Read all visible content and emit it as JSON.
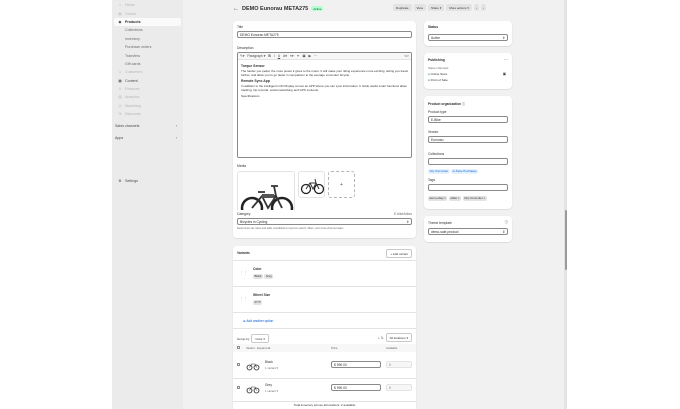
{
  "sidebar": {
    "items": [
      {
        "label": "Home",
        "icon": "home-icon",
        "state": "dim"
      },
      {
        "label": "Orders",
        "icon": "orders-icon",
        "state": "dim"
      },
      {
        "label": "Products",
        "icon": "tag-icon",
        "state": "active"
      },
      {
        "label": "Collections",
        "state": "sub"
      },
      {
        "label": "Inventory",
        "state": "sub"
      },
      {
        "label": "Purchase orders",
        "state": "sub"
      },
      {
        "label": "Transfers",
        "state": "sub"
      },
      {
        "label": "Gift cards",
        "state": "sub"
      },
      {
        "label": "Customers",
        "icon": "person-icon",
        "state": "dim"
      },
      {
        "label": "Content",
        "icon": "content-icon",
        "state": "dark"
      },
      {
        "label": "Finances",
        "icon": "bank-icon",
        "state": "dim"
      },
      {
        "label": "Analytics",
        "icon": "chart-icon",
        "state": "dim"
      },
      {
        "label": "Marketing",
        "icon": "target-icon",
        "state": "dim"
      },
      {
        "label": "Discounts",
        "icon": "discount-icon",
        "state": "dim"
      }
    ],
    "sales_channels_label": "Sales channels",
    "apps_label": "Apps",
    "settings_label": "Settings"
  },
  "header": {
    "title": "DEMO Eunorau META275",
    "status": "Active",
    "actions": [
      "Duplicate",
      "View",
      "Share",
      "More actions"
    ]
  },
  "product": {
    "title_label": "Title",
    "title_value": "DEMO Eunorau META275",
    "description_label": "Description",
    "toolbar_paragraph": "Paragraph",
    "desc_heading1": "Torque Sensor",
    "desc_para1": "The harder you pedal, the more power it gives to the motor. It will make your riding experience more exciting, letting you travel further, and allow you to go faster in comparison to the average commuter bicycle.",
    "desc_heading2": "Remote Sync App",
    "desc_para2": "In addition to the intelligent LCD Display comes an APP where you can sync information. It holds useful smart functions allow tracking, trip records, social networking and GPS contents.",
    "desc_heading3": "Specifications",
    "media_label": "Media",
    "media_add": "+",
    "category_label": "Category",
    "category_right": "E-bike/bikes",
    "category_value": "Bicycles in Cycling",
    "category_help": "Determines tax rates and adds metafields to improve search, filters, and cross-channel sales"
  },
  "variants": {
    "heading": "Variants",
    "add_button": "+ Add variant",
    "options": [
      {
        "name": "Color",
        "values": [
          "Black",
          "Grey"
        ]
      },
      {
        "name": "Wheel Size",
        "values": [
          "27.5\""
        ]
      }
    ],
    "add_option": "Add another option",
    "group_by_label": "Group by",
    "group_by_value": "Color",
    "locations": "All locations",
    "col_variant": "Variant · Expand all",
    "col_price": "Price",
    "col_available": "Available",
    "rows": [
      {
        "name": "Black",
        "sub": "1 variant",
        "currency": "$",
        "price": "990.00",
        "available": "0"
      },
      {
        "name": "Grey",
        "sub": "1 variant",
        "currency": "$",
        "price": "990.00",
        "available": "0"
      }
    ],
    "total": "Total inventory across all locations: 2 available"
  },
  "status_card": {
    "label": "Status",
    "value": "Active"
  },
  "publishing": {
    "label": "Publishing",
    "sales_channels": "Sales channels",
    "channels": [
      "Online Store",
      "Point of Sale"
    ]
  },
  "organization": {
    "label": "Product organization",
    "type_label": "Product type",
    "type_value": "E-Bike",
    "vendor_label": "Vendor",
    "vendor_value": "Eunorau",
    "collections_label": "Collections",
    "collections": [
      "City Commuter",
      "In-Store Purchases"
    ],
    "tags_label": "Tags",
    "tags": [
      "demo-ebay",
      "ebike",
      "City Commuter"
    ]
  },
  "theme": {
    "label": "Theme template",
    "value": "demo-sale-product"
  }
}
